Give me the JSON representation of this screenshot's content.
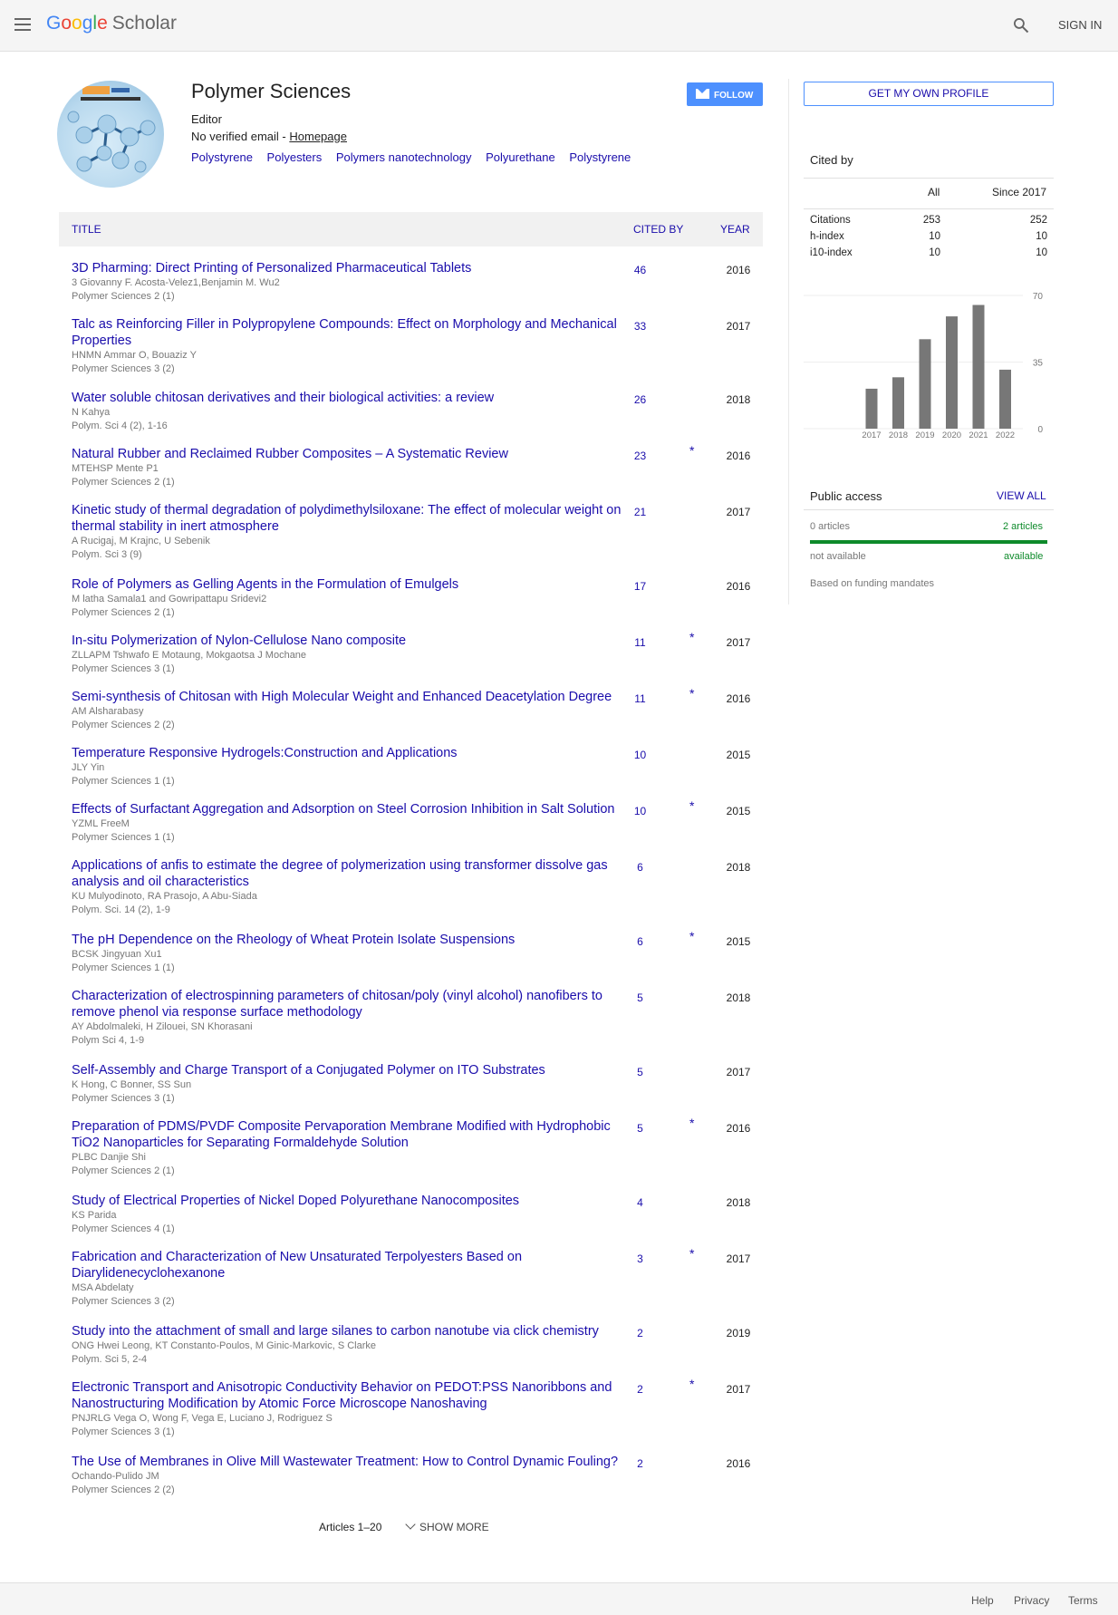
{
  "header": {
    "logo_letters": [
      "G",
      "o",
      "o",
      "g",
      "l",
      "e"
    ],
    "logo_scholar": "Scholar",
    "signin": "SIGN IN"
  },
  "profile": {
    "name": "Polymer Sciences",
    "affiliation": "Editor",
    "email_prefix": "No verified email - ",
    "homepage": "Homepage",
    "interests": [
      "Polystyrene",
      "Polyesters",
      "Polymers nanotechnology",
      "Polyurethane",
      "Polystyrene"
    ],
    "follow": "FOLLOW"
  },
  "table": {
    "col_title": "TITLE",
    "col_cited": "CITED BY",
    "col_year": "YEAR"
  },
  "articles": [
    {
      "title": "3D Pharming: Direct Printing of Personalized Pharmaceutical Tablets",
      "authors": "3 Giovanny F. Acosta-Velez1,Benjamin M. Wu2",
      "venue": "Polymer Sciences 2 (1)",
      "cites": "46",
      "star": "",
      "year": "2016"
    },
    {
      "title": "Talc as Reinforcing Filler in Polypropylene Compounds: Effect on Morphology and Mechanical Properties",
      "authors": "HNMN Ammar O, Bouaziz Y",
      "venue": "Polymer Sciences 3 (2)",
      "cites": "33",
      "star": "",
      "year": "2017"
    },
    {
      "title": "Water soluble chitosan derivatives and their biological activities: a review",
      "authors": "N Kahya",
      "venue": "Polym. Sci 4 (2), 1-16",
      "cites": "26",
      "star": "",
      "year": "2018"
    },
    {
      "title": "Natural Rubber and Reclaimed Rubber Composites – A Systematic Review",
      "authors": "MTEHSP Mente P1",
      "venue": "Polymer Sciences 2 (1)",
      "cites": "23",
      "star": "*",
      "year": "2016"
    },
    {
      "title": "Kinetic study of thermal degradation of polydimethylsiloxane: The effect of molecular weight on thermal stability in inert atmosphere",
      "authors": "A Rucigaj, M Krajnc, U Sebenik",
      "venue": "Polym. Sci 3 (9)",
      "cites": "21",
      "star": "",
      "year": "2017"
    },
    {
      "title": "Role of Polymers as Gelling Agents in the Formulation of Emulgels",
      "authors": "M latha Samala1 and Gowripattapu Sridevi2",
      "venue": "Polymer Sciences 2 (1)",
      "cites": "17",
      "star": "",
      "year": "2016"
    },
    {
      "title": "In-situ Polymerization of Nylon-Cellulose Nano composite",
      "authors": "ZLLAPM Tshwafo E Motaung, Mokgaotsa J Mochane",
      "venue": "Polymer Sciences 3 (1)",
      "cites": "11",
      "star": "*",
      "year": "2017"
    },
    {
      "title": "Semi-synthesis of Chitosan with High Molecular Weight and Enhanced Deacetylation Degree",
      "authors": "AM Alsharabasy",
      "venue": "Polymer Sciences 2 (2)",
      "cites": "11",
      "star": "*",
      "year": "2016"
    },
    {
      "title": "Temperature Responsive Hydrogels:Construction and Applications",
      "authors": "JLY Yin",
      "venue": "Polymer Sciences 1 (1)",
      "cites": "10",
      "star": "",
      "year": "2015"
    },
    {
      "title": "Effects of Surfactant Aggregation and Adsorption on Steel Corrosion Inhibition in Salt Solution",
      "authors": "YZML FreeM",
      "venue": "Polymer Sciences 1 (1)",
      "cites": "10",
      "star": "*",
      "year": "2015"
    },
    {
      "title": "Applications of anfis to estimate the degree of polymerization using transformer dissolve gas analysis and oil characteristics",
      "authors": "KU Mulyodinoto, RA Prasojo, A Abu-Siada",
      "venue": "Polym. Sci. 14 (2), 1-9",
      "cites": "6",
      "star": "",
      "year": "2018"
    },
    {
      "title": "The pH Dependence on the Rheology of Wheat Protein Isolate Suspensions",
      "authors": "BCSK Jingyuan Xu1",
      "venue": "Polymer Sciences 1 (1)",
      "cites": "6",
      "star": "*",
      "year": "2015"
    },
    {
      "title": "Characterization of electrospinning parameters of chitosan/poly (vinyl alcohol) nanofibers to remove phenol via response surface methodology",
      "authors": "AY Abdolmaleki, H Zilouei, SN Khorasani",
      "venue": "Polym Sci 4, 1-9",
      "cites": "5",
      "star": "",
      "year": "2018"
    },
    {
      "title": "Self-Assembly and Charge Transport of a Conjugated Polymer on ITO Substrates",
      "authors": "K Hong, C Bonner, SS Sun",
      "venue": "Polymer Sciences 3 (1)",
      "cites": "5",
      "star": "",
      "year": "2017"
    },
    {
      "title": "Preparation of PDMS/PVDF Composite Pervaporation Membrane Modified with Hydrophobic TiO2 Nanoparticles for Separating Formaldehyde Solution",
      "authors": "PLBC Danjie Shi",
      "venue": "Polymer Sciences 2 (1)",
      "cites": "5",
      "star": "*",
      "year": "2016"
    },
    {
      "title": "Study of Electrical Properties of Nickel Doped Polyurethane Nanocomposites",
      "authors": "KS Parida",
      "venue": "Polymer Sciences 4 (1)",
      "cites": "4",
      "star": "",
      "year": "2018"
    },
    {
      "title": "Fabrication and Characterization of New Unsaturated Terpolyesters Based on Diarylidenecyclohexanone",
      "authors": "MSA Abdelaty",
      "venue": "Polymer Sciences 3 (2)",
      "cites": "3",
      "star": "*",
      "year": "2017"
    },
    {
      "title": "Study into the attachment of small and large silanes to carbon nanotube via click chemistry",
      "authors": "ONG Hwei Leong, KT Constanto-Poulos, M Ginic-Markovic, S Clarke",
      "venue": "Polym. Sci 5, 2-4",
      "cites": "2",
      "star": "",
      "year": "2019"
    },
    {
      "title": "Electronic Transport and Anisotropic Conductivity Behavior on PEDOT:PSS Nanoribbons and Nanostructuring Modification by Atomic Force Microscope Nanoshaving",
      "authors": "PNJRLG Vega O, Wong F, Vega E, Luciano J, Rodriguez S",
      "venue": "Polymer Sciences 3 (1)",
      "cites": "2",
      "star": "*",
      "year": "2017"
    },
    {
      "title": "The Use of Membranes in Olive Mill Wastewater Treatment: How to Control Dynamic Fouling?",
      "authors": "Ochando-Pulido JM",
      "venue": "Polymer Sciences 2 (2)",
      "cites": "2",
      "star": "",
      "year": "2016"
    }
  ],
  "pagination": {
    "range": "Articles 1–20",
    "show_more": "SHOW MORE"
  },
  "sidebar": {
    "get_profile": "GET MY OWN PROFILE",
    "cited_by": "Cited by",
    "col_all": "All",
    "col_since": "Since 2017",
    "stats": [
      {
        "label": "Citations",
        "all": "253",
        "since": "252"
      },
      {
        "label": "h-index",
        "all": "10",
        "since": "10"
      },
      {
        "label": "i10-index",
        "all": "10",
        "since": "10"
      }
    ],
    "public_access": "Public access",
    "view_all": "VIEW ALL",
    "articles_0": "0 articles",
    "articles_2": "2 articles",
    "not_available": "not available",
    "available": "available",
    "funding": "Based on funding mandates"
  },
  "chart_data": {
    "type": "bar",
    "categories": [
      "2017",
      "2018",
      "2019",
      "2020",
      "2021",
      "2022"
    ],
    "values": [
      21,
      27,
      47,
      59,
      65,
      31
    ],
    "yticks": [
      "70",
      "35",
      "0"
    ],
    "ylim": [
      0,
      70
    ],
    "bar_color": "#777777"
  },
  "footer": {
    "help": "Help",
    "privacy": "Privacy",
    "terms": "Terms"
  }
}
